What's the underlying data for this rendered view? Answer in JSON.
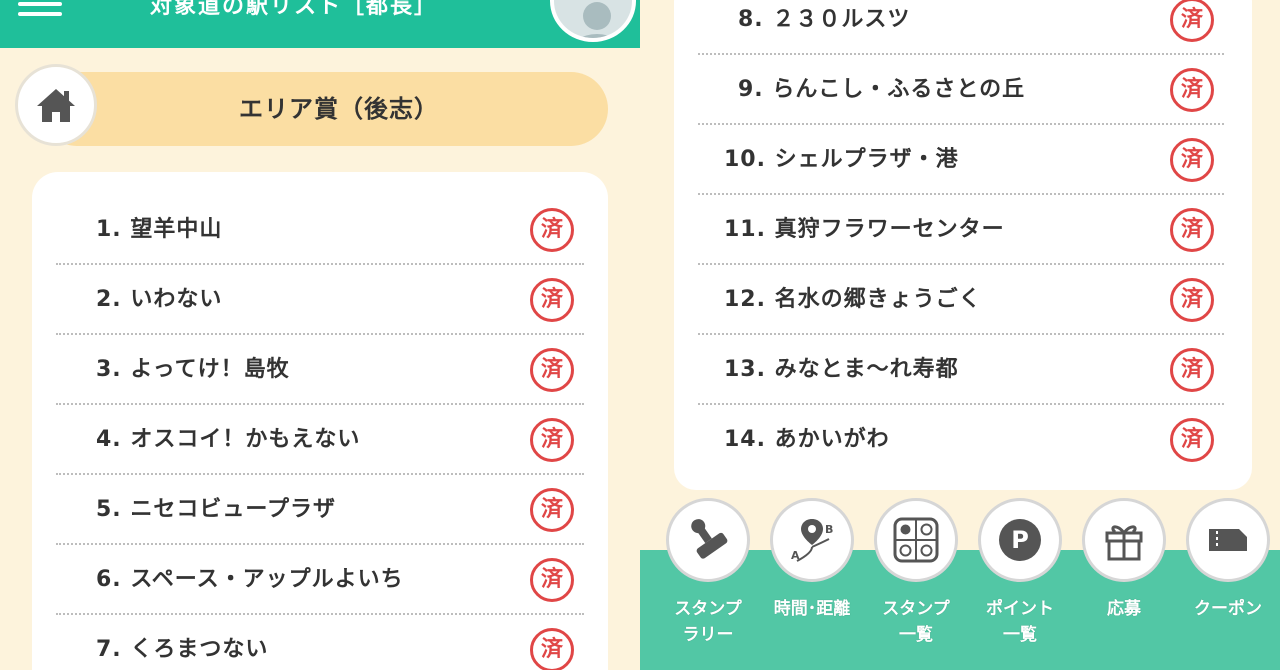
{
  "header": {
    "title": "対象道の駅リスト［都長］",
    "colors": {
      "header_bg": "#1fbf9a",
      "page_bg": "#fdf3dc",
      "banner_bg": "#fbdea3",
      "stamp_red": "#e04646",
      "nav_bg": "#52c7a5"
    }
  },
  "area": {
    "label": "エリア賞（後志）",
    "home_icon": "home-icon"
  },
  "stamp_text": "済",
  "left_list": [
    {
      "label": "1. 望羊中山"
    },
    {
      "label": "2. いわない"
    },
    {
      "label": "3. よってけ！島牧"
    },
    {
      "label": "4. オスコイ！かもえない"
    },
    {
      "label": "5. ニセコビュープラザ"
    },
    {
      "label": "6. スペース・アップルよいち"
    },
    {
      "label": "7. くろまつない"
    }
  ],
  "right_list": [
    {
      "label": "8. ２３０ルスツ"
    },
    {
      "label": "9. らんこし・ふるさとの丘"
    },
    {
      "label": "10. シェルプラザ・港"
    },
    {
      "label": "11. 真狩フラワーセンター"
    },
    {
      "label": "12. 名水の郷きょうごく"
    },
    {
      "label": "13. みなとま〜れ寿都"
    },
    {
      "label": "14. あかいがわ"
    }
  ],
  "bottom_nav": [
    {
      "label": "スタンプ\nラリー",
      "icon": "stamp-icon"
    },
    {
      "label": "時間･距離",
      "icon": "route-icon"
    },
    {
      "label": "スタンプ\n一覧",
      "icon": "grid-icon"
    },
    {
      "label": "ポイント\n一覧",
      "icon": "point-icon"
    },
    {
      "label": "応募",
      "icon": "gift-icon"
    },
    {
      "label": "クーポン",
      "icon": "coupon-icon"
    }
  ]
}
